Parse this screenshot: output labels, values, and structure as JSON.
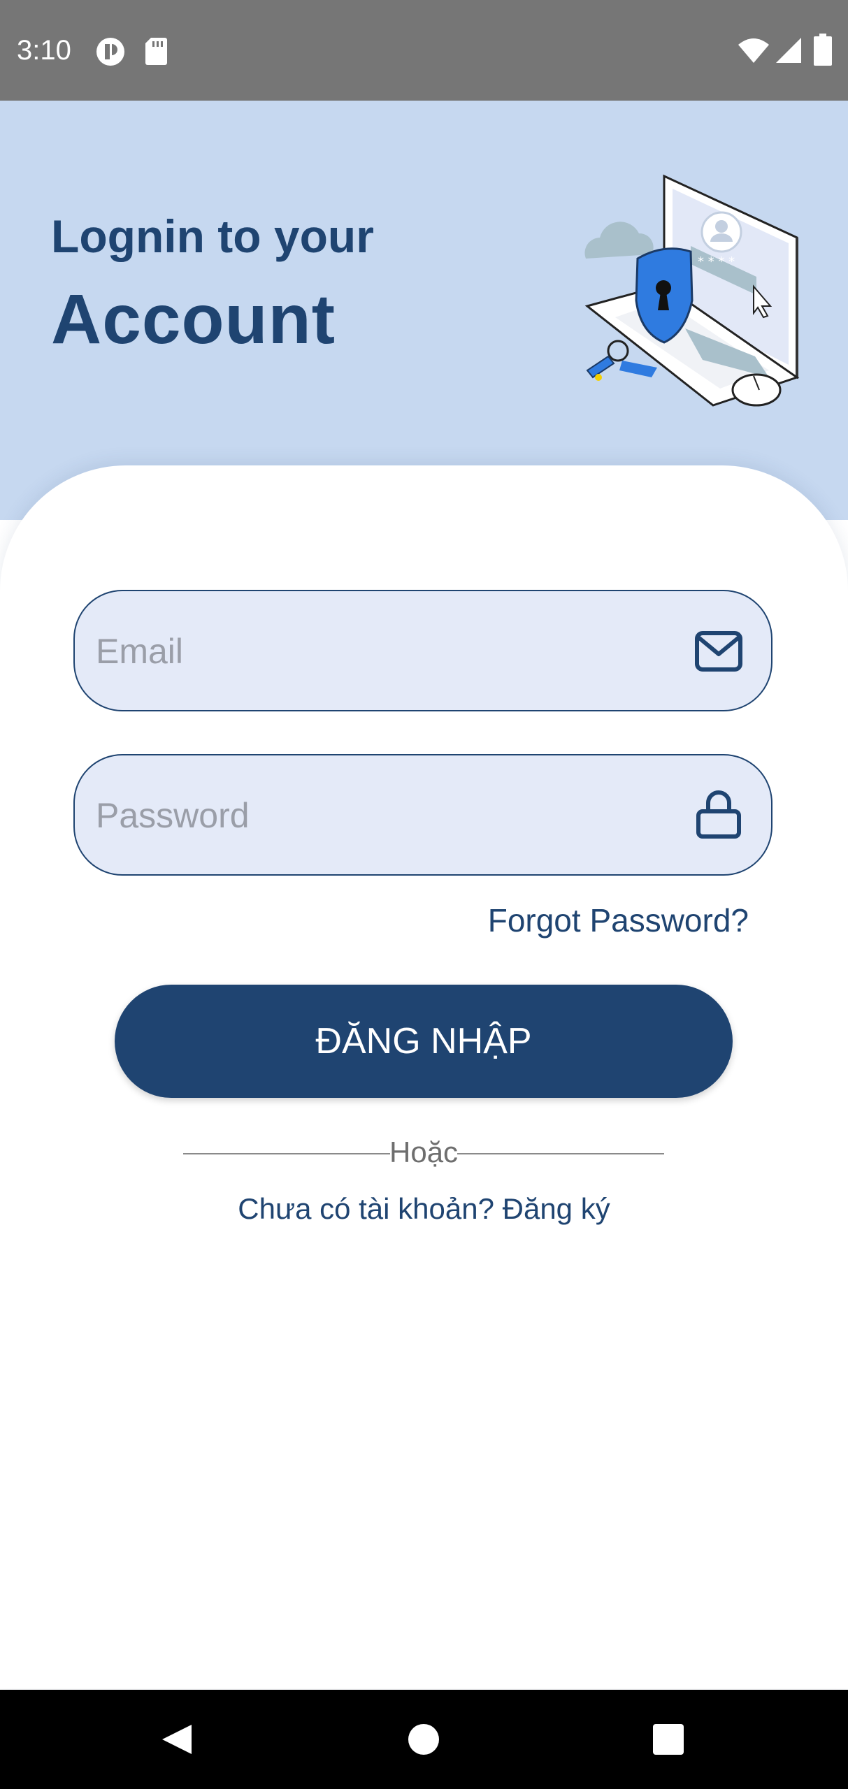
{
  "status_bar": {
    "time": "3:10",
    "left_icons": [
      "notification-app-icon",
      "sd-card-icon"
    ],
    "right_icons": [
      "wifi-icon",
      "signal-icon",
      "battery-icon"
    ]
  },
  "header": {
    "title_line1": "Lognin to your",
    "title_line2": "Account",
    "illustration": "laptop-security-illustration"
  },
  "form": {
    "email": {
      "placeholder": "Email",
      "value": "",
      "icon": "envelope-icon"
    },
    "password": {
      "placeholder": "Password",
      "value": "",
      "icon": "lock-icon"
    },
    "forgot_password": "Forgot Password?",
    "login_button": "ĐĂNG NHẬP",
    "divider_text": "Hoặc",
    "register_link": "Chưa có tài khoản? Đăng ký"
  },
  "nav_bar": {
    "buttons": [
      "back-icon",
      "home-icon",
      "recents-icon"
    ]
  },
  "colors": {
    "primary": "#1f4471",
    "header_bg": "#c6d8f0",
    "field_bg": "#e4eaf8"
  }
}
